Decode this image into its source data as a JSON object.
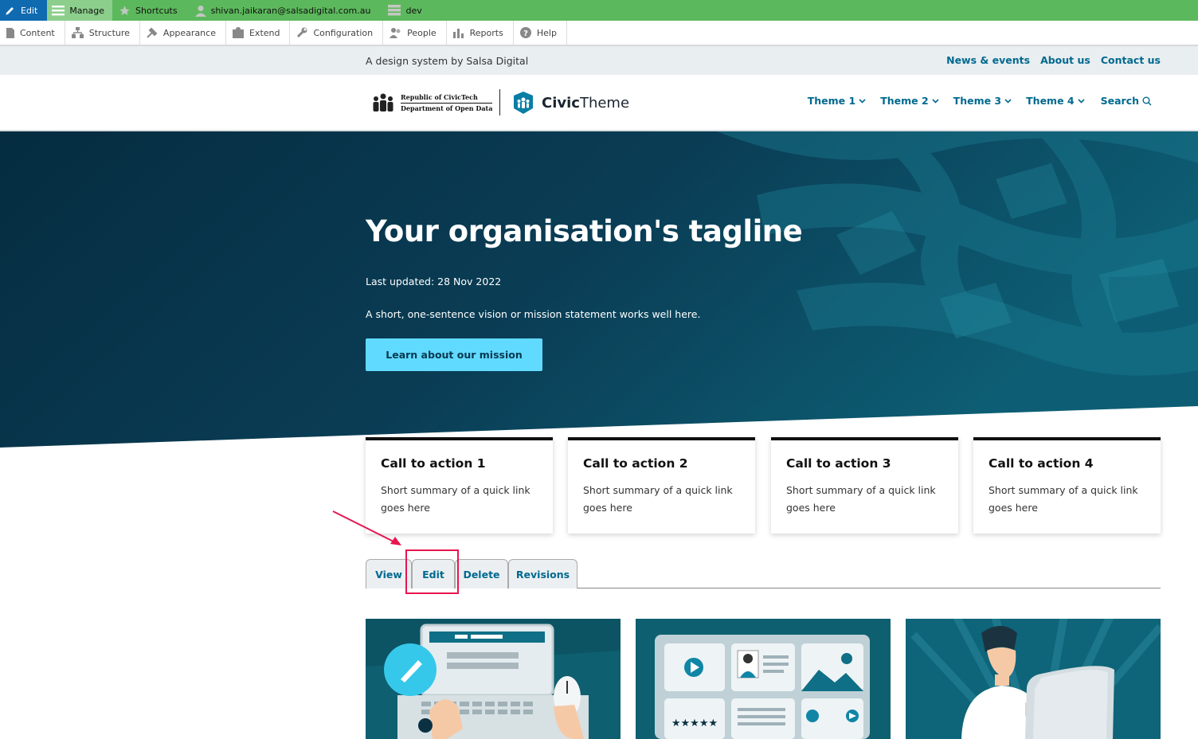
{
  "toolbar": {
    "edit_label": "Edit",
    "manage_label": "Manage",
    "shortcuts_label": "Shortcuts",
    "user_label": "shivan.jaikaran@salsadigital.com.au",
    "env_label": "dev",
    "tray": [
      {
        "label": "Content",
        "icon": "content-icon"
      },
      {
        "label": "Structure",
        "icon": "structure-icon"
      },
      {
        "label": "Appearance",
        "icon": "appearance-icon"
      },
      {
        "label": "Extend",
        "icon": "extend-icon"
      },
      {
        "label": "Configuration",
        "icon": "configuration-icon"
      },
      {
        "label": "People",
        "icon": "people-icon"
      },
      {
        "label": "Reports",
        "icon": "reports-icon"
      },
      {
        "label": "Help",
        "icon": "help-icon"
      }
    ]
  },
  "site": {
    "slogan": "A design system by Salsa Digital",
    "secondary_nav": [
      "News & events",
      "About us",
      "Contact us"
    ]
  },
  "header": {
    "gov_line1": "Republic of CivicTech",
    "gov_line2": "Department of Open Data",
    "brand_bold": "Civic",
    "brand_light": "Theme",
    "main_nav": [
      "Theme 1",
      "Theme 2",
      "Theme 3",
      "Theme 4"
    ],
    "search_label": "Search"
  },
  "hero": {
    "title": "Your organisation's tagline",
    "updated": "Last updated: 28 Nov 2022",
    "summary": "A short, one-sentence vision or mission statement works well here.",
    "button_label": "Learn about our mission"
  },
  "cta_cards": [
    {
      "title": "Call to action 1",
      "text": "Short summary of a quick link goes here"
    },
    {
      "title": "Call to action 2",
      "text": "Short summary of a quick link goes here"
    },
    {
      "title": "Call to action 3",
      "text": "Short summary of a quick link goes here"
    },
    {
      "title": "Call to action 4",
      "text": "Short summary of a quick link goes here"
    }
  ],
  "tabs": [
    "View",
    "Edit",
    "Delete",
    "Revisions"
  ],
  "colors": {
    "toolbar_green": "#5cb85c",
    "toolbar_edit_blue": "#0f6ab0",
    "link_teal": "#00698f",
    "hero_dark": "#0a3a52",
    "button_cyan": "#61daff",
    "annotation_red": "#e8154f"
  }
}
